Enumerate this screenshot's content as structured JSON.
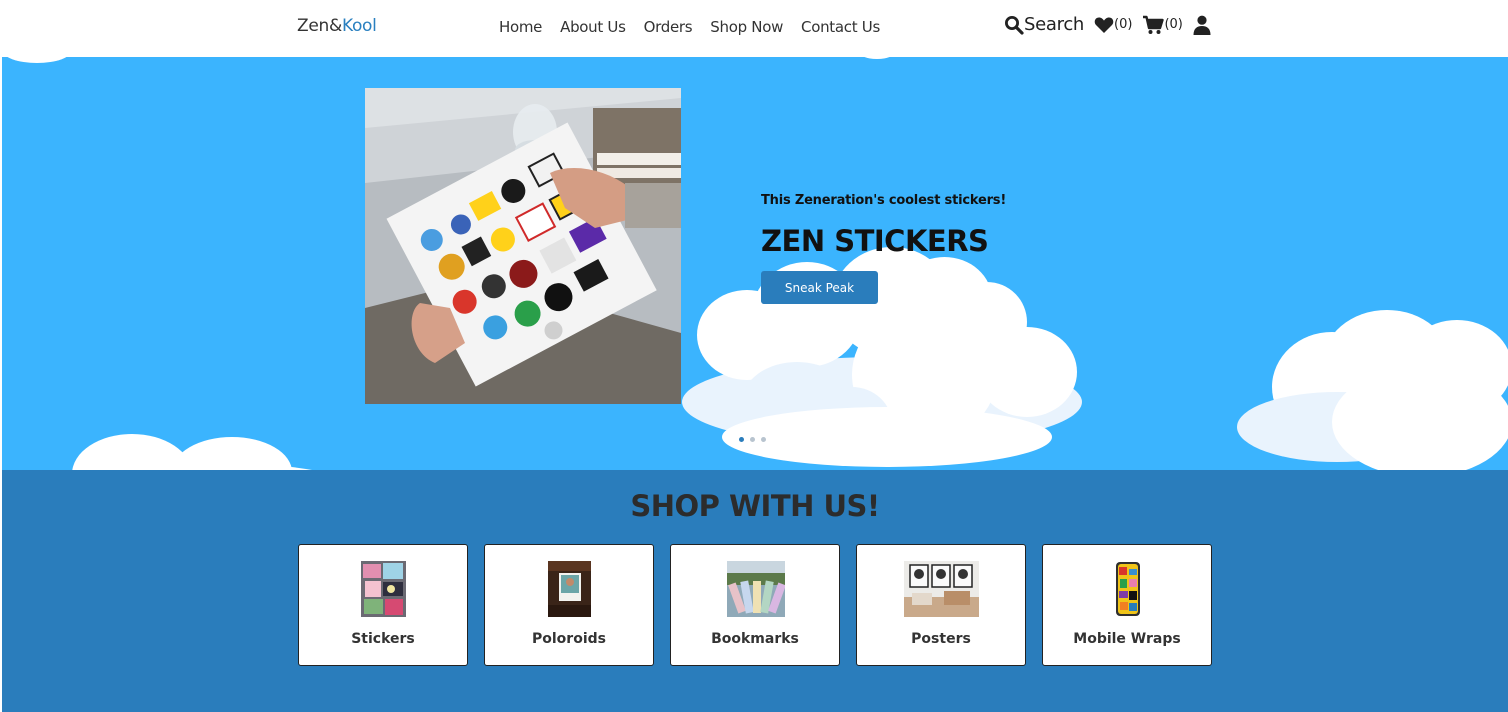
{
  "nav": {
    "brand_main": "Zen&",
    "brand_accent": "Kool",
    "links": [
      "Home",
      "About Us",
      "Orders",
      "Shop Now",
      "Contact Us"
    ],
    "search_label": "Search",
    "wishlist_count": "(0)",
    "cart_count": "(0)",
    "icons": [
      "search-icon",
      "heart-icon",
      "cart-icon",
      "user-icon"
    ]
  },
  "hero": {
    "subtitle": "This Zeneration's coolest stickers!",
    "title": "ZEN STICKERS",
    "button_label": "Sneak Peak",
    "slide_count": 3,
    "active_slide": 1
  },
  "shop": {
    "title": "SHOP WITH US!",
    "categories": [
      {
        "label": "Stickers"
      },
      {
        "label": "Poloroids"
      },
      {
        "label": "Bookmarks"
      },
      {
        "label": "Posters"
      },
      {
        "label": "Mobile Wraps"
      }
    ]
  },
  "colors": {
    "sky": "#3bb4fe",
    "accent": "#2a7dbc",
    "shop_bg": "#2a7dbc",
    "brand_accent": "#2a80c0"
  }
}
